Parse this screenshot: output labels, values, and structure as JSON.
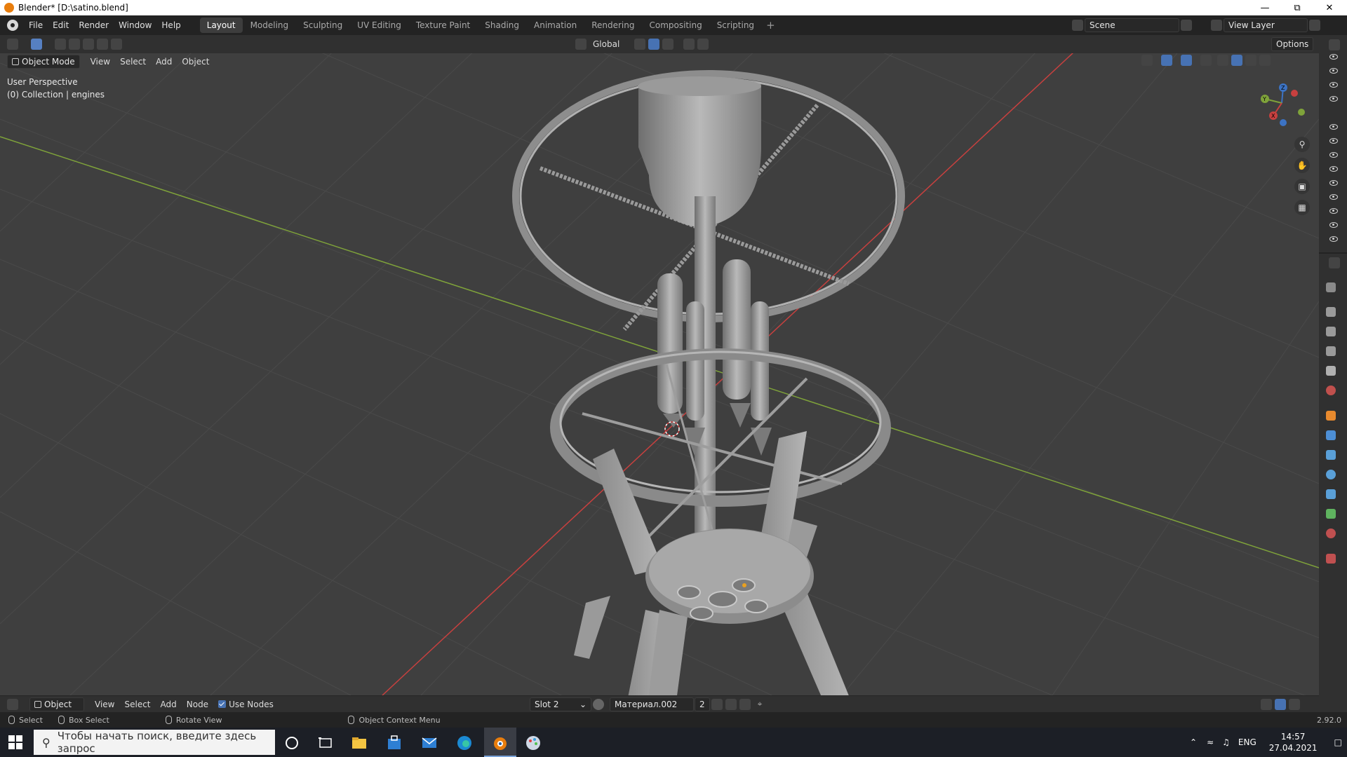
{
  "window": {
    "title": "Blender* [D:\\satino.blend]"
  },
  "menubar": {
    "menus": [
      "File",
      "Edit",
      "Render",
      "Window",
      "Help"
    ],
    "workspaces": [
      "Layout",
      "Modeling",
      "Sculpting",
      "UV Editing",
      "Texture Paint",
      "Shading",
      "Animation",
      "Rendering",
      "Compositing",
      "Scripting"
    ],
    "active_workspace": "Layout",
    "scene_name": "Scene",
    "view_layer": "View Layer"
  },
  "viewport_header": {
    "transform_orientation": "Global",
    "options_label": "Options",
    "mode": "Object Mode",
    "menus": [
      "View",
      "Select",
      "Add",
      "Object"
    ]
  },
  "viewport": {
    "perspective_label": "User Perspective",
    "collection_label": "(0) Collection | engines",
    "axis_colors": {
      "x": "#c8403f",
      "y": "#7fa33a",
      "z": "#3c73c4"
    },
    "gizmo_labels": [
      "Z",
      "Y",
      "X"
    ]
  },
  "node_header": {
    "editor_type": "Object",
    "menus": [
      "View",
      "Select",
      "Add",
      "Node"
    ],
    "use_nodes_label": "Use Nodes",
    "use_nodes": true,
    "slot": "Slot 2",
    "material": "Материал.002",
    "users": "2"
  },
  "statusbar": {
    "select": "Select",
    "box_select": "Box Select",
    "rotate_view": "Rotate View",
    "context_menu": "Object Context Menu",
    "version": "2.92.0"
  },
  "taskbar": {
    "search_placeholder": "Чтобы начать поиск, введите здесь запрос",
    "language": "ENG",
    "time": "14:57",
    "date": "27.04.2021"
  }
}
